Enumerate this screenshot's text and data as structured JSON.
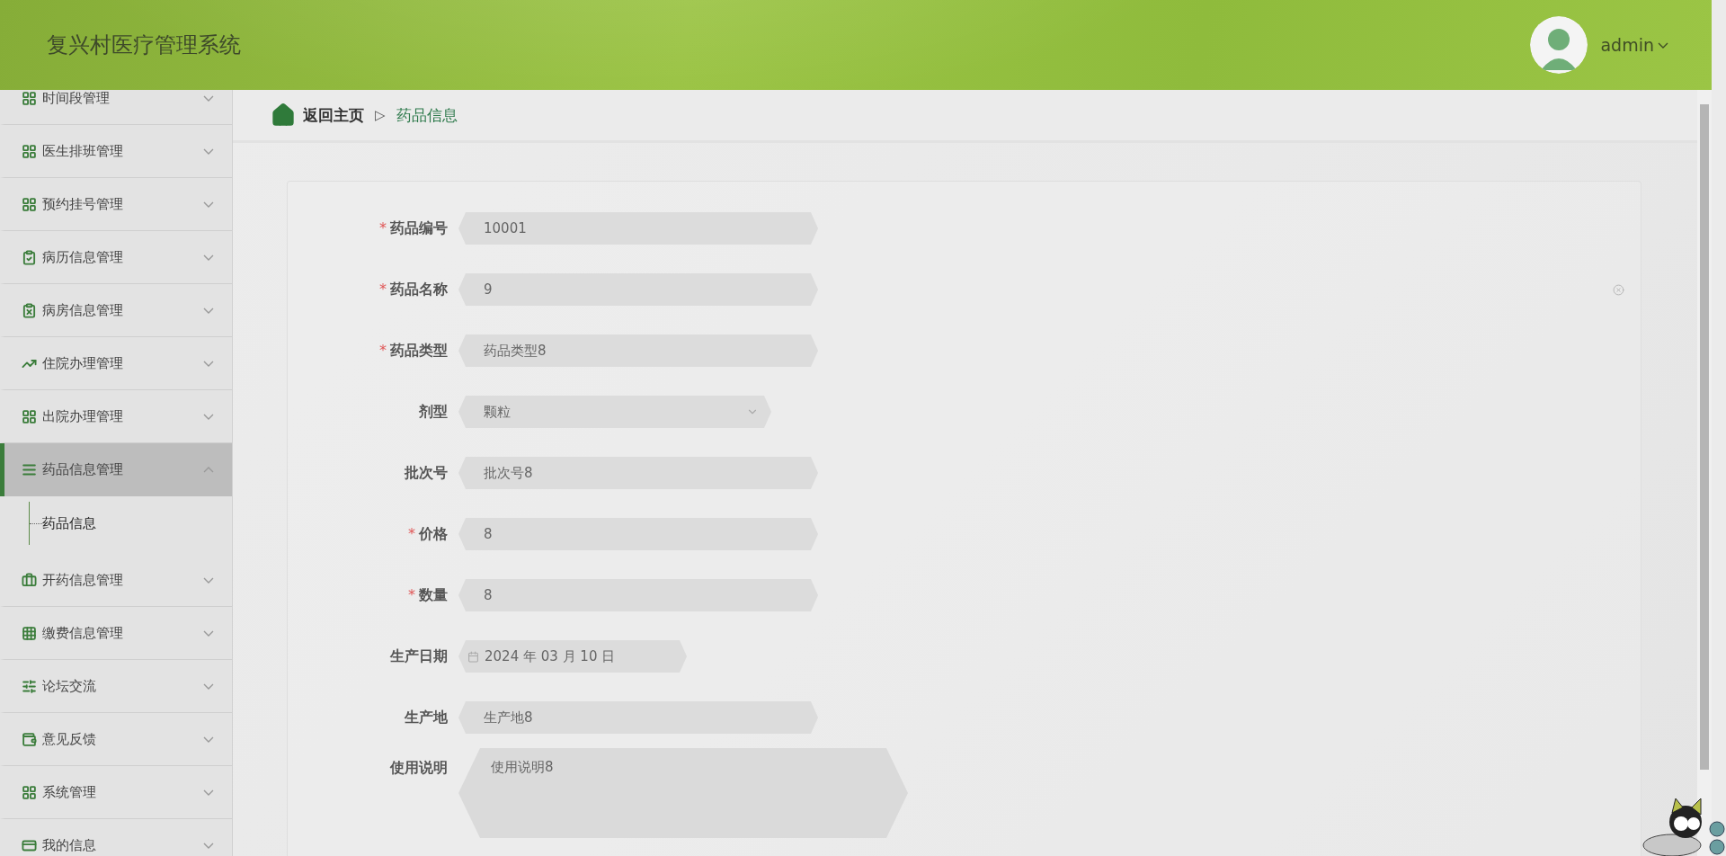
{
  "header": {
    "title": "复兴村医疗管理系统",
    "user": "admin"
  },
  "sidebar": {
    "items": [
      {
        "label": "时间段管理",
        "expanded": false,
        "selected": false
      },
      {
        "label": "医生排班管理",
        "expanded": false,
        "selected": false
      },
      {
        "label": "预约挂号管理",
        "expanded": false,
        "selected": false
      },
      {
        "label": "病历信息管理",
        "expanded": false,
        "selected": false
      },
      {
        "label": "病房信息管理",
        "expanded": false,
        "selected": false
      },
      {
        "label": "住院办理管理",
        "expanded": false,
        "selected": false
      },
      {
        "label": "出院办理管理",
        "expanded": false,
        "selected": false
      },
      {
        "label": "药品信息管理",
        "expanded": true,
        "selected": true,
        "children": [
          {
            "label": "药品信息"
          }
        ]
      },
      {
        "label": "开药信息管理",
        "expanded": false,
        "selected": false
      },
      {
        "label": "缴费信息管理",
        "expanded": false,
        "selected": false
      },
      {
        "label": "论坛交流",
        "expanded": false,
        "selected": false
      },
      {
        "label": "意见反馈",
        "expanded": false,
        "selected": false
      },
      {
        "label": "系统管理",
        "expanded": false,
        "selected": false
      },
      {
        "label": "我的信息",
        "expanded": false,
        "selected": false
      }
    ]
  },
  "breadcrumb": {
    "home": "返回主页",
    "separator": "▷",
    "current": "药品信息"
  },
  "form": {
    "fields": [
      {
        "label": "药品编号",
        "kind": "text",
        "required_mark": "*",
        "value": "10001"
      },
      {
        "label": "药品名称",
        "kind": "text",
        "required_mark": "*",
        "value": "9",
        "clearable": true
      },
      {
        "label": "药品类型",
        "kind": "text",
        "required_mark": "*",
        "value": "药品类型8"
      },
      {
        "label": "剂型",
        "kind": "select",
        "value": "颗粒"
      },
      {
        "label": "批次号",
        "kind": "text",
        "value": "批次号8"
      },
      {
        "label": "价格",
        "kind": "text",
        "required_mark": "*",
        "value": "8"
      },
      {
        "label": "数量",
        "kind": "text",
        "required_mark": "*",
        "value": "8"
      },
      {
        "label": "生产日期",
        "kind": "date",
        "value": "2024 年 03 月 10 日"
      },
      {
        "label": "生产地",
        "kind": "text",
        "value": "生产地8"
      },
      {
        "label": "使用说明",
        "kind": "textarea",
        "value": "使用说明8"
      }
    ]
  }
}
